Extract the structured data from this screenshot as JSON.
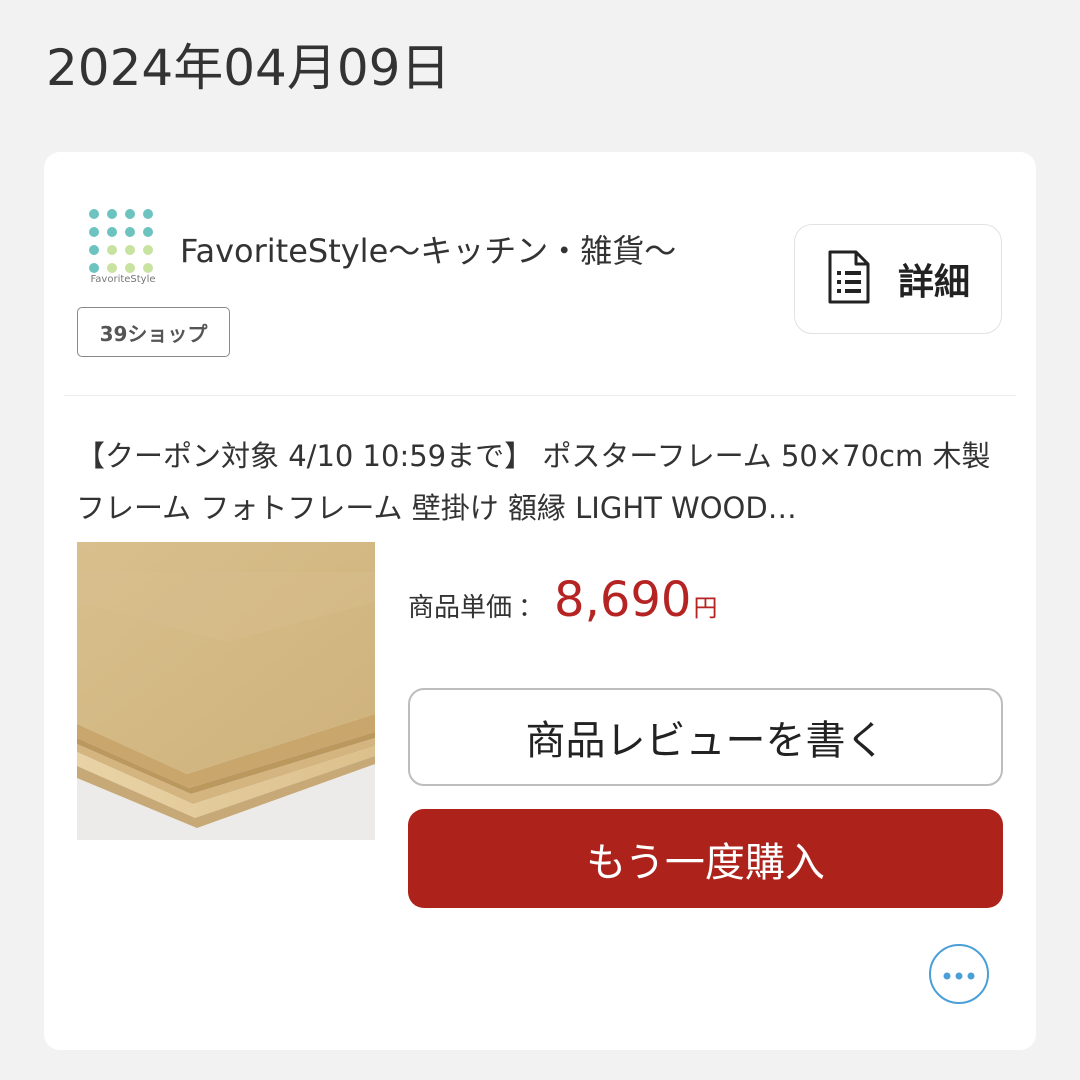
{
  "date": "2024年04月09日",
  "shop": {
    "name": "FavoriteStyle〜キッチン・雑貨〜",
    "logo_text": "FavoriteStyle",
    "badge": "39ショップ",
    "detail_label": "詳細"
  },
  "product": {
    "title": "【クーポン対象 4/10 10:59まで】 ポスターフレーム 50×70cm 木製 フレーム フォトフレーム 壁掛け 額縁 LIGHT WOOD…",
    "price_label": "商品単価",
    "price_separator": "：",
    "price_value": "8,690",
    "price_unit": "円"
  },
  "actions": {
    "review_label": "商品レビューを書く",
    "rebuy_label": "もう一度購入"
  },
  "icons": {
    "detail": "document-list-icon",
    "more": "more-dots-icon"
  },
  "colors": {
    "accent_red": "#ad231b",
    "price_red": "#b52323",
    "more_blue": "#4a9fd8",
    "logo_teal": "#6cc3c0",
    "logo_green": "#c8e3a0"
  }
}
